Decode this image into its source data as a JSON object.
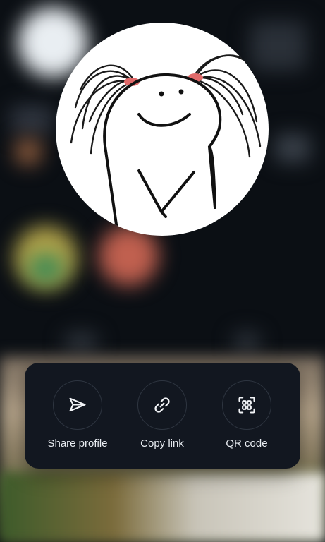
{
  "share_sheet": {
    "actions": [
      {
        "label": "Share profile",
        "icon": "send-icon"
      },
      {
        "label": "Copy link",
        "icon": "link-icon"
      },
      {
        "label": "QR code",
        "icon": "qr-code-icon"
      }
    ]
  },
  "colors": {
    "panel_bg": "#121720",
    "text": "#e9edf2",
    "icon_stroke": "#f2f4f7",
    "avatar_bg": "#ffffff",
    "bow": "#e06a6a"
  }
}
